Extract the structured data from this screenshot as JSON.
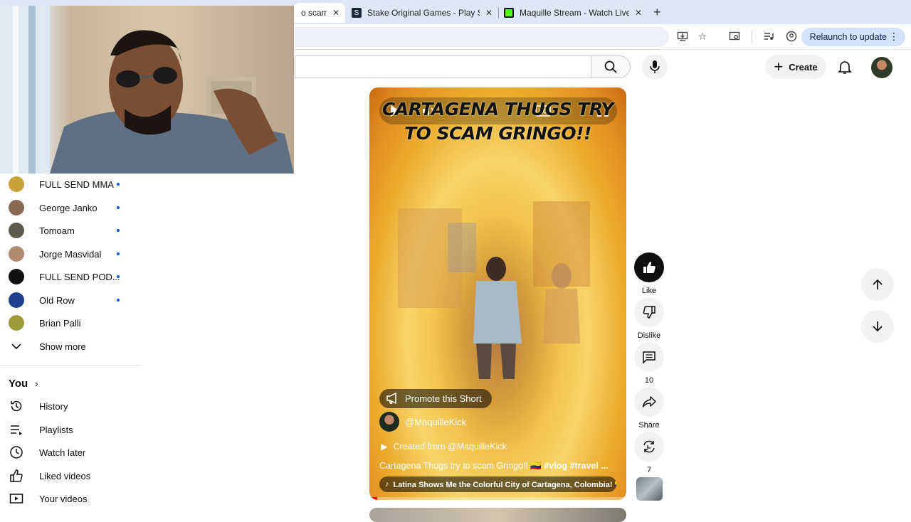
{
  "browser": {
    "tabs": [
      {
        "title": "o scam",
        "active": true
      },
      {
        "title": "Stake Original Games - Play S",
        "active": false
      },
      {
        "title": "Maquille Stream - Watch Live",
        "active": false
      }
    ],
    "new_tab": "+",
    "relaunch_label": "Relaunch to update"
  },
  "header": {
    "create_label": "Create"
  },
  "sidebar": {
    "subscriptions": [
      {
        "name": "FULL SEND MMA",
        "color": "#c9a23a"
      },
      {
        "name": "George Janko",
        "color": "#8a6a55"
      },
      {
        "name": "Tomoam",
        "color": "#5d5a4e"
      },
      {
        "name": "Jorge Masvidal",
        "color": "#b08a70"
      },
      {
        "name": "FULL SEND POD...",
        "color": "#111111"
      },
      {
        "name": "Old Row",
        "color": "#1c3f8e"
      },
      {
        "name": "Brian Palli",
        "color": "#9a9a3a"
      }
    ],
    "show_more": "Show more",
    "you_label": "You",
    "you_items": [
      {
        "label": "History",
        "icon": "history-icon"
      },
      {
        "label": "Playlists",
        "icon": "playlists-icon"
      },
      {
        "label": "Watch later",
        "icon": "watch-later-icon"
      },
      {
        "label": "Liked videos",
        "icon": "liked-icon"
      },
      {
        "label": "Your videos",
        "icon": "your-videos-icon"
      }
    ]
  },
  "short": {
    "title_line1": "CARTAGENA THUGS TRY",
    "title_line2": "TO SCAM GRINGO!!",
    "promote_label": "Promote this Short",
    "channel": "@MaquilleKick",
    "created_from": "Created from @MaquilleKick",
    "description": "Cartagena Thugs try to scam Gringo!! 🇨🇴",
    "hashtags": "#vlog #travel ...",
    "music": "Latina Shows Me the Colorful City of Cartagena, Colombia! 🇨🇴...",
    "progress": 0.03
  },
  "actions": {
    "like_label": "Like",
    "dislike_label": "Dislike",
    "comments_count": "10",
    "share_label": "Share",
    "remix_count": "7"
  }
}
